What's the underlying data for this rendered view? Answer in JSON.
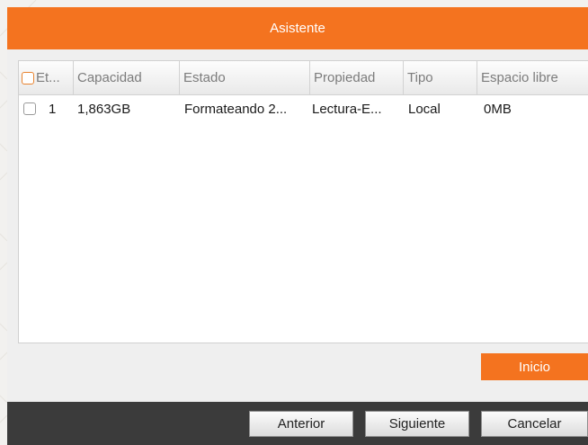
{
  "dialog": {
    "title": "Asistente"
  },
  "table": {
    "columns": [
      "Et...",
      "Capacidad",
      "Estado",
      "Propiedad",
      "Tipo",
      "Espacio libre"
    ],
    "rows": [
      {
        "label": "1",
        "capacity": "1,863GB",
        "status": "Formateando 2...",
        "property": "Lectura-E...",
        "type": "Local",
        "free_space": "0MB"
      }
    ]
  },
  "buttons": {
    "start": "Inicio",
    "previous": "Anterior",
    "next": "Siguiente",
    "cancel": "Cancelar"
  },
  "colors": {
    "accent": "#f4731f",
    "footer": "#3b3b3b",
    "dialog_bg": "#efefef"
  }
}
